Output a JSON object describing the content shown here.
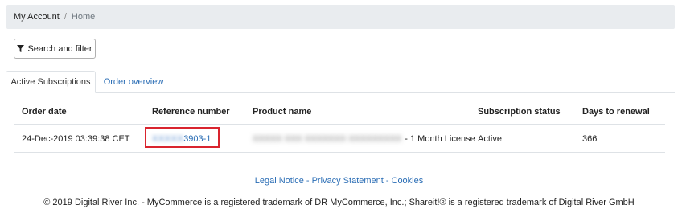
{
  "breadcrumb": {
    "account": "My Account",
    "separator": "/",
    "current": "Home"
  },
  "toolbar": {
    "search_filter_label": "Search and filter",
    "filter_icon": "filter-icon"
  },
  "tabs": [
    {
      "label": "Active Subscriptions",
      "active": true
    },
    {
      "label": "Order overview",
      "active": false
    }
  ],
  "table": {
    "headers": [
      "Order date",
      "Reference number",
      "Product name",
      "Subscription status",
      "Days to renewal"
    ],
    "rows": [
      {
        "order_date": "24-Dec-2019 03:39:38 CET",
        "reference_redacted": "XXXXX",
        "reference_suffix": "3903-1",
        "product_redacted": "XXXXX XXX XXXXXXX XXXXXXXXX",
        "product_suffix": "- 1 Month License",
        "status": "Active",
        "days_to_renewal": "366"
      }
    ]
  },
  "footer": {
    "legal_notice": "Legal Notice",
    "privacy_statement": "Privacy Statement",
    "cookies": "Cookies",
    "separator": "-",
    "copyright": "© 2019 Digital River Inc. - MyCommerce is a registered trademark of DR MyCommerce, Inc.; Shareit!® is a registered trademark of Digital River GmbH"
  },
  "colors": {
    "link": "#2a6db5",
    "highlight": "#d9242e",
    "breadcrumb_bg": "#e9ecef"
  }
}
